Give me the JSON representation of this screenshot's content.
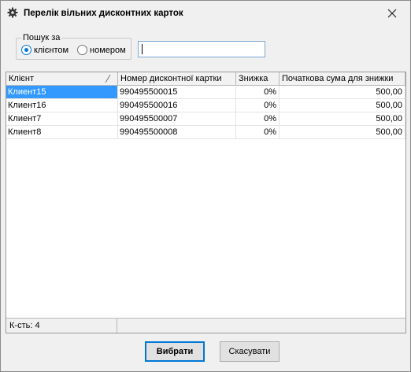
{
  "window": {
    "title": "Перелік вільних дисконтних карток"
  },
  "search": {
    "group_label": "Пошук за",
    "option_client": "клієнтом",
    "option_number": "номером",
    "selected": "клієнтом",
    "value": ""
  },
  "table": {
    "columns": [
      "Клієнт",
      "Номер дисконтної картки",
      "Знижка",
      "Початкова сума для знижки"
    ],
    "rows": [
      [
        "Клиент15",
        "990495500015",
        "0%",
        "500,00"
      ],
      [
        "Клиент16",
        "990495500016",
        "0%",
        "500,00"
      ],
      [
        "Клиент7",
        "990495500007",
        "0%",
        "500,00"
      ],
      [
        "Клиент8",
        "990495500008",
        "0%",
        "500,00"
      ]
    ],
    "selected_row": 0,
    "footer_count": "К-сть: 4"
  },
  "buttons": {
    "ok": "Вибрати",
    "cancel": "Скасувати"
  },
  "colors": {
    "accent": "#0078d7",
    "selection": "#3399ff"
  },
  "icons": {
    "window": "gear-icon",
    "close": "close-icon",
    "sort": "sort-indicator-icon"
  }
}
